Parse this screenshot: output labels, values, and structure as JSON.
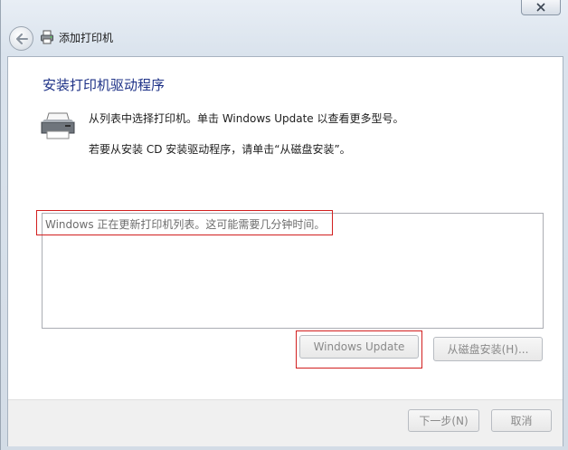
{
  "window": {
    "title": "添加打印机",
    "close_symbol": "✕",
    "icons": {
      "back": "back-arrow-icon",
      "title_printer": "printer-icon",
      "wizard_printer": "printer-icon",
      "close": "close-icon"
    }
  },
  "content": {
    "heading": "安装打印机驱动程序",
    "instruction_line1": "从列表中选择打印机。单击 Windows Update 以查看更多型号。",
    "instruction_line2": "若要从安装 CD 安装驱动程序，请单击“从磁盘安装”。",
    "list_status": "Windows 正在更新打印机列表。这可能需要几分钟时间。"
  },
  "buttons": {
    "windows_update": "Windows Update",
    "have_disk": "从磁盘安装(H)...",
    "next": "下一步(N)",
    "cancel": "取消"
  },
  "colors": {
    "heading": "#1e3287",
    "highlight_box": "#d21f1f",
    "disabled_text": "#8a8a8a"
  }
}
